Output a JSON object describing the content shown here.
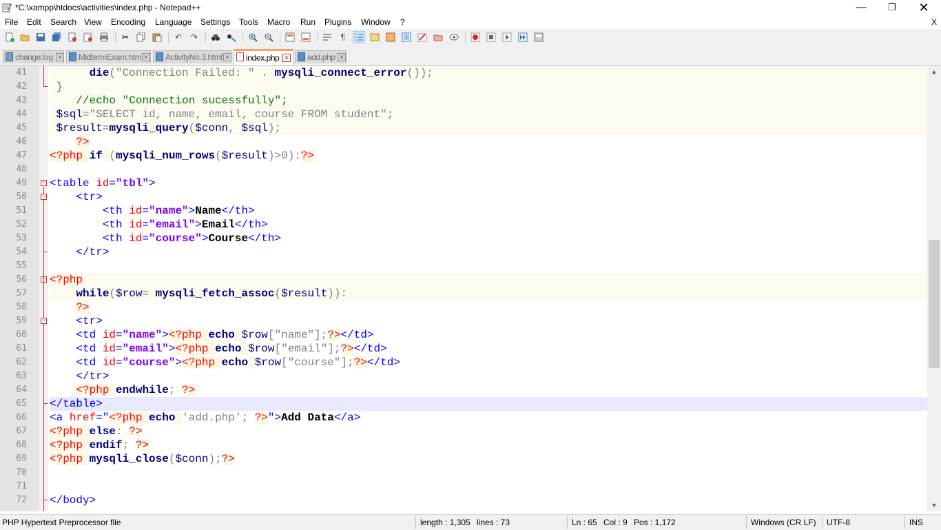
{
  "window": {
    "title": "*C:\\xampp\\htdocs\\activities\\index.php - Notepad++",
    "minimize": "—",
    "maximize": "❐",
    "close": "✕"
  },
  "menu": {
    "items": [
      "File",
      "Edit",
      "Search",
      "View",
      "Encoding",
      "Language",
      "Settings",
      "Tools",
      "Macro",
      "Run",
      "Plugins",
      "Window",
      "?"
    ],
    "doc_close": "X"
  },
  "toolbar": {
    "icons": [
      "new-file-icon",
      "open-file-icon",
      "save-icon",
      "save-all-icon",
      "close-icon",
      "close-all-icon",
      "print-icon",
      "cut-icon",
      "copy-icon",
      "paste-icon",
      "undo-icon",
      "redo-icon",
      "find-icon",
      "replace-icon",
      "zoom-in-icon",
      "zoom-out-icon",
      "sync-vertical-icon",
      "sync-horizontal-icon",
      "word-wrap-icon",
      "show-all-characters-icon",
      "indent-guide-icon",
      "user-language-icon",
      "doc-map-icon",
      "function-list-icon",
      "folder-as-workspace-icon",
      "monitoring-icon",
      "record-macro-icon",
      "stop-record-icon",
      "playback-macro-icon",
      "run-macro-multiple-icon",
      "save-macro-icon"
    ]
  },
  "tabs": [
    {
      "label": "change.log",
      "close": "✕",
      "active": false
    },
    {
      "label": "MidtermExam.html",
      "close": "✕",
      "active": false
    },
    {
      "label": "ActivityNo.3.html",
      "close": "✕",
      "active": false
    },
    {
      "label": "index.php",
      "close": "✕",
      "active": true
    },
    {
      "label": "add.php",
      "close": "✕",
      "active": false
    }
  ],
  "editor": {
    "line_numbers": [
      "41",
      "42",
      "43",
      "44",
      "45",
      "46",
      "47",
      "48",
      "49",
      "50",
      "51",
      "52",
      "53",
      "54",
      "55",
      "56",
      "57",
      "58",
      "59",
      "60",
      "61",
      "62",
      "63",
      "64",
      "65",
      "66",
      "67",
      "68",
      "69",
      "70",
      "71",
      "72"
    ],
    "current_line": "65"
  },
  "scrollbar": {
    "up": "▲",
    "down": "▼"
  },
  "status": {
    "file_type": "PHP Hypertext Preprocessor file",
    "length": "length : 1,305",
    "lines": "lines : 73",
    "ln": "Ln : 65",
    "col": "Col : 9",
    "pos": "Pos : 1,172",
    "eol": "Windows (CR LF)",
    "encoding": "UTF-8",
    "mode": "INS"
  },
  "colors": {
    "keyword": "#000080",
    "php_delimiter": "#ff0000",
    "html_tag": "#0000ff",
    "attribute": "#ff0000",
    "attribute_value": "#8000ff",
    "comment": "#008000",
    "string": "#808080",
    "active_tab_accent": "#f7a35c",
    "current_line": "#e8e8ff"
  }
}
